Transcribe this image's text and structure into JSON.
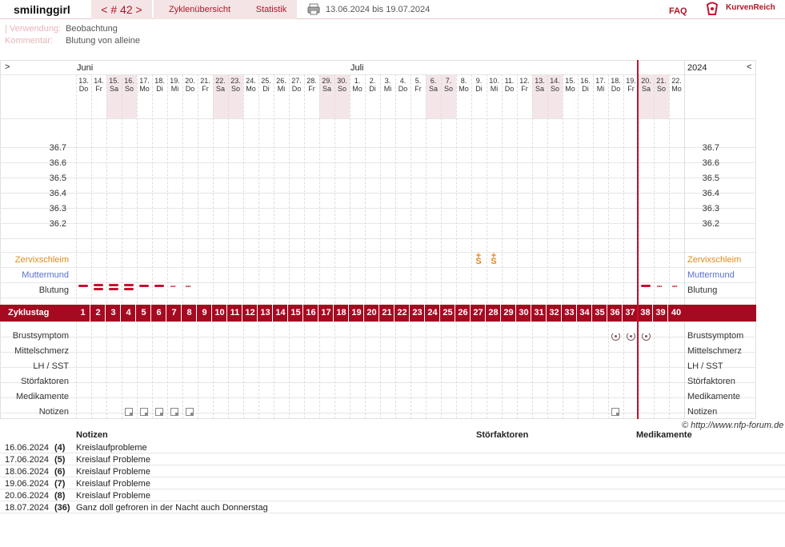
{
  "header": {
    "username": "smilinggirl",
    "cycle_label": "< # 42 >",
    "tab_cycles": "Zyklenübersicht",
    "tab_stats": "Statistik",
    "date_range": "13.06.2024 bis 19.07.2024",
    "faq": "FAQ",
    "brand": "KurvenReich",
    "accent": "#a40b20"
  },
  "meta": {
    "usage_label": "| Verwendung:",
    "usage_value": "Beobachtung",
    "comment_label": "Kommentar:",
    "comment_value": "Blutung von alleine"
  },
  "chart": {
    "nav_left": ">",
    "nav_right": "<",
    "year": "2024",
    "month_june": "Juni",
    "month_july": "Juli",
    "days": [
      [
        "13.",
        "Do"
      ],
      [
        "14.",
        "Fr"
      ],
      [
        "15.",
        "Sa"
      ],
      [
        "16.",
        "So"
      ],
      [
        "17.",
        "Mo"
      ],
      [
        "18.",
        "Di"
      ],
      [
        "19.",
        "Mi"
      ],
      [
        "20.",
        "Do"
      ],
      [
        "21.",
        "Fr"
      ],
      [
        "22.",
        "Sa"
      ],
      [
        "23.",
        "So"
      ],
      [
        "24.",
        "Mo"
      ],
      [
        "25.",
        "Di"
      ],
      [
        "26.",
        "Mi"
      ],
      [
        "27.",
        "Do"
      ],
      [
        "28.",
        "Fr"
      ],
      [
        "29.",
        "Sa"
      ],
      [
        "30.",
        "So"
      ],
      [
        "1.",
        "Mo"
      ],
      [
        "2.",
        "Di"
      ],
      [
        "3.",
        "Mi"
      ],
      [
        "4.",
        "Do"
      ],
      [
        "5.",
        "Fr"
      ],
      [
        "6.",
        "Sa"
      ],
      [
        "7.",
        "So"
      ],
      [
        "8.",
        "Mo"
      ],
      [
        "9.",
        "Di"
      ],
      [
        "10.",
        "Mi"
      ],
      [
        "11.",
        "Do"
      ],
      [
        "12.",
        "Fr"
      ],
      [
        "13.",
        "Sa"
      ],
      [
        "14.",
        "So"
      ],
      [
        "15.",
        "Mo"
      ],
      [
        "16.",
        "Di"
      ],
      [
        "17.",
        "Mi"
      ],
      [
        "18.",
        "Do"
      ],
      [
        "19.",
        "Fr"
      ],
      [
        "20.",
        "Sa"
      ],
      [
        "21.",
        "So"
      ],
      [
        "22.",
        "Mo"
      ]
    ],
    "temps": [
      "36.7",
      "36.6",
      "36.5",
      "36.4",
      "36.3",
      "36.2"
    ],
    "row_labels": {
      "cervix": "Zervixschleim",
      "muttermund": "Muttermund",
      "blutung": "Blutung",
      "zyklustag": "Zyklustag",
      "brust": "Brustsymptom",
      "mittel": "Mittelschmerz",
      "lh": "LH / SST",
      "stor": "Störfaktoren",
      "med": "Medikamente",
      "notizen": "Notizen"
    },
    "cycle_days": [
      "1",
      "2",
      "3",
      "4",
      "5",
      "6",
      "7",
      "8",
      "9",
      "10",
      "11",
      "12",
      "13",
      "14",
      "15",
      "16",
      "17",
      "18",
      "19",
      "20",
      "21",
      "22",
      "23",
      "24",
      "25",
      "26",
      "27",
      "28",
      "29",
      "30",
      "31",
      "32",
      "33",
      "34",
      "35",
      "36",
      "37",
      "38",
      "39",
      "40"
    ],
    "mucus_symbol": "S",
    "copyright": "© http://www.nfp-forum.de"
  },
  "notes_table": {
    "headers": {
      "notes": "Notizen",
      "stor": "Störfaktoren",
      "med": "Medikamente"
    },
    "rows": [
      {
        "date": "16.06.2024",
        "day": "(4)",
        "text": "Kreislaufprobleme"
      },
      {
        "date": "17.06.2024",
        "day": "(5)",
        "text": "Kreislauf Probleme"
      },
      {
        "date": "18.06.2024",
        "day": "(6)",
        "text": "Kreislauf Probleme"
      },
      {
        "date": "19.06.2024",
        "day": "(7)",
        "text": "Kreislauf Probleme"
      },
      {
        "date": "20.06.2024",
        "day": "(8)",
        "text": "Kreislauf Probleme"
      },
      {
        "date": "18.07.2024",
        "day": "(36)",
        "text": "Ganz doll gefroren in der Nacht auch Donnerstag"
      }
    ]
  }
}
